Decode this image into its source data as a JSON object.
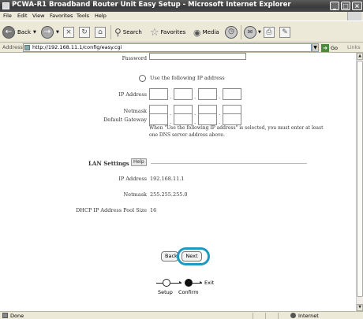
{
  "window": {
    "title": "PCWA-R1 Broadband Router Unit Easy Setup - Microsoft Internet Explorer",
    "controls": [
      "_",
      "□",
      "×"
    ]
  },
  "menu": [
    "File",
    "Edit",
    "View",
    "Favorites",
    "Tools",
    "Help"
  ],
  "toolbar": {
    "back": "Back",
    "search": "Search",
    "favorites": "Favorites",
    "media": "Media"
  },
  "address": {
    "label": "Address",
    "url": "http://192.168.11.1/config/easy.cgi",
    "go": "Go",
    "links": "Links"
  },
  "form": {
    "password_label": "Password",
    "use_following_ip": "Use the following IP address",
    "ip_address_label": "IP Address",
    "netmask_label": "Netmask",
    "default_gateway_label": "Default Gateway",
    "note": "When \"Use the following IP address\" is selected, you must enter at least one DNS server address above."
  },
  "lan": {
    "title": "LAN Settings",
    "help": "Help",
    "ip_address_label": "IP Address",
    "ip_address_value": "192.168.11.1",
    "netmask_label": "Netmask",
    "netmask_value": "255.255.255.0",
    "pool_size_label": "DHCP IP Address Pool Size",
    "pool_size_value": "16"
  },
  "nav": {
    "back": "Back",
    "next": "Next",
    "highlight_color": "#1e9ac0"
  },
  "steps": {
    "setup": "Setup",
    "confirm": "Confirm",
    "exit": "Exit"
  },
  "status": {
    "text": "Done",
    "zone": "Internet"
  }
}
